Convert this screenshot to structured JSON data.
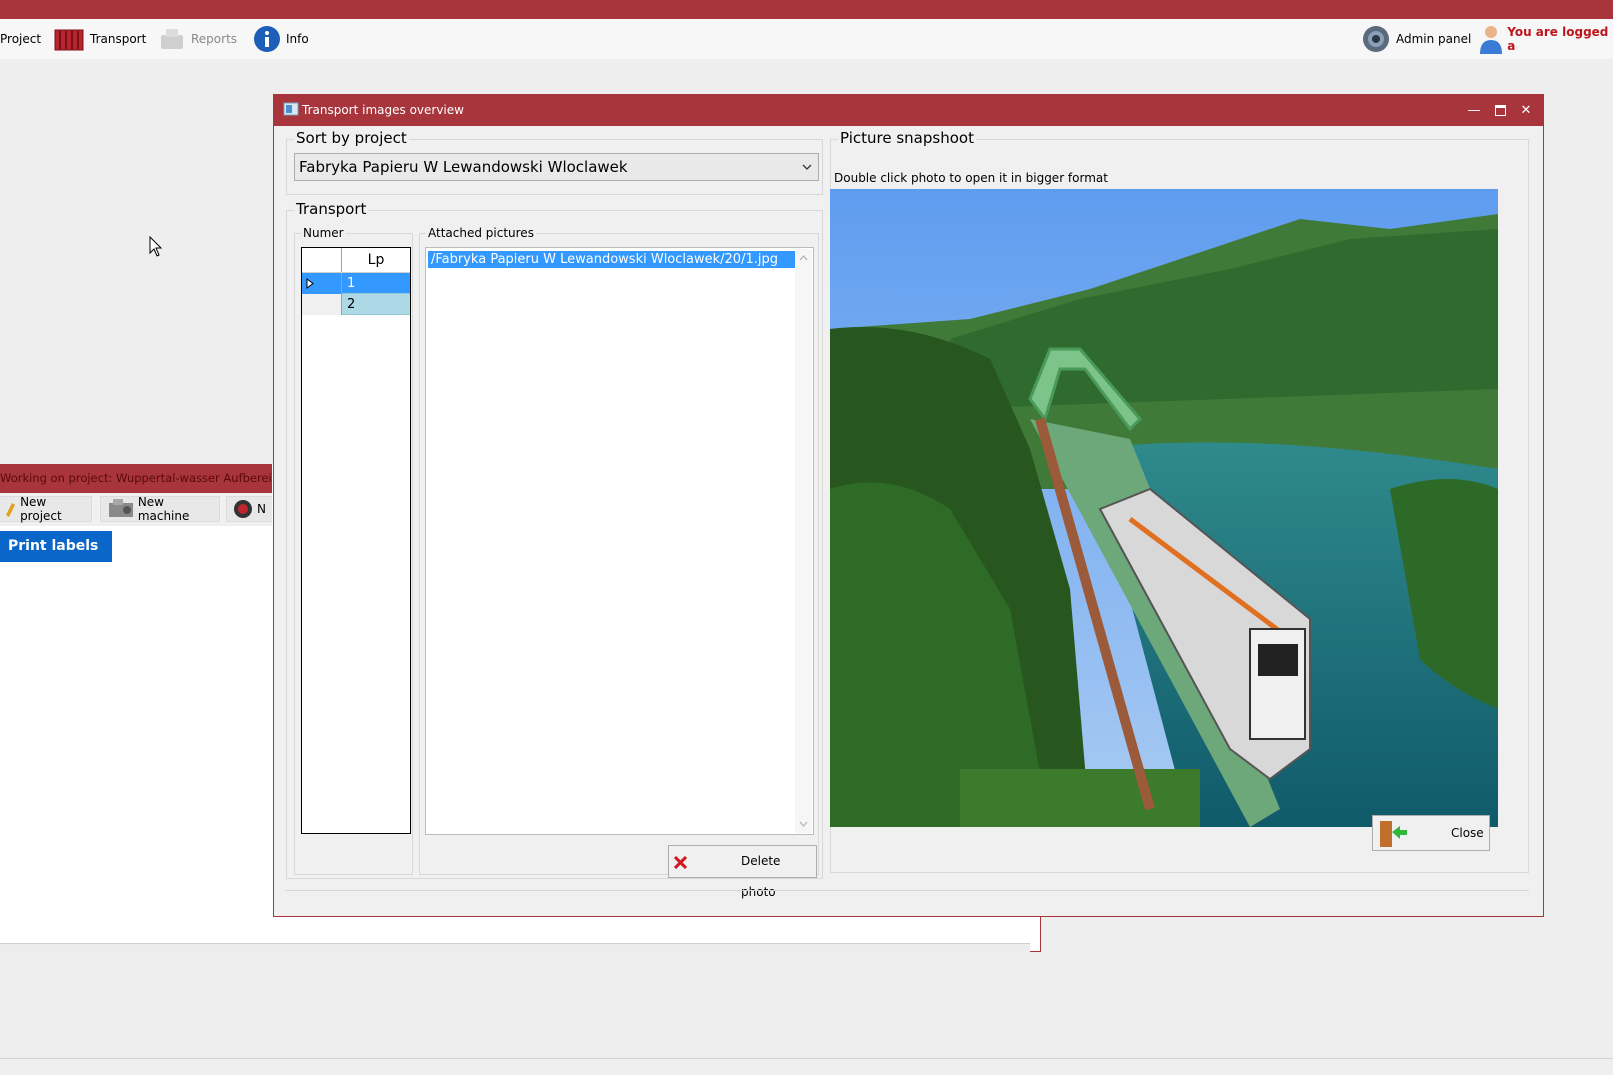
{
  "menu": {
    "project_label": "Project",
    "transport_label": "Transport",
    "reports_label": "Reports",
    "info_label": "Info",
    "admin_label": "Admin panel",
    "logged_text": "You are logged a"
  },
  "bg_window": {
    "title": "Working on project: Wuppertal-wasser Aufbereitung",
    "new_project": "New project",
    "new_machine": "New machine",
    "third_button_fragment": "N",
    "print_labels": "Print labels"
  },
  "dialog": {
    "title": "Transport images overview",
    "sort_group_title": "Sort by project",
    "project_selected": "Fabryka Papieru W Lewandowski Wloclawek",
    "transport_group_title": "Transport",
    "numer_label": "Numer",
    "grid_header": "Lp",
    "grid_rows": [
      "1",
      "2"
    ],
    "attached_label": "Attached pictures",
    "attached_items": [
      "/Fabryka Papieru W Lewandowski Wloclawek/20/1.jpg"
    ],
    "delete_button": "Delete photo",
    "picture_group_title": "Picture snapshoot",
    "picture_hint": "Double click photo to open it in bigger format",
    "close_button": "Close"
  },
  "colors": {
    "titlebar": "#a8343c",
    "selection": "#3399ff",
    "logged_text": "#c0141c",
    "print_button": "#0a66c8"
  }
}
